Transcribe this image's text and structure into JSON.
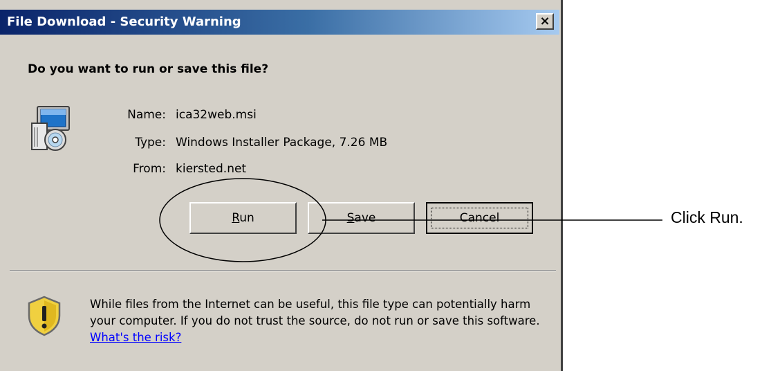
{
  "dialog": {
    "title": "File Download - Security Warning",
    "close_label": "×",
    "question": "Do you want to run or save this file?",
    "icon": "installer-package-icon",
    "file": {
      "name_label": "Name:",
      "name_value": "ica32web.msi",
      "type_label": "Type:",
      "type_value": "Windows Installer Package, 7.26 MB",
      "from_label": "From:",
      "from_value": "kiersted.net"
    },
    "buttons": {
      "run_hotkey": "R",
      "run_rest": "un",
      "save_hotkey": "S",
      "save_rest": "ave",
      "cancel": "Cancel"
    },
    "warning": {
      "icon": "security-shield-icon",
      "text": "While files from the Internet can be useful, this file type can potentially harm your computer. If you do not trust the source, do not run or save this software.",
      "link": "What's the risk?"
    }
  },
  "annotation": {
    "text": "Click Run."
  },
  "colors": {
    "dialog_bg": "#d4d0c8",
    "titlebar_start": "#0a246a",
    "titlebar_end": "#a6caf0",
    "link": "#0000ff"
  }
}
